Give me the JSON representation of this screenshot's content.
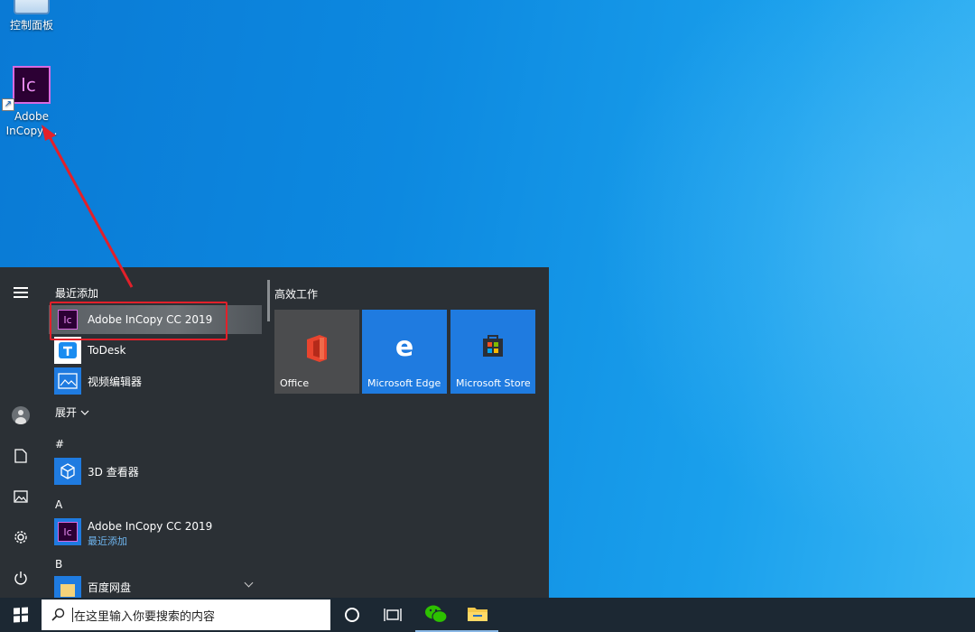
{
  "desktop": {
    "icons": [
      {
        "label": "控制面板"
      },
      {
        "label_line1": "Adobe",
        "label_line2": "InCopy ..."
      }
    ]
  },
  "start_menu": {
    "recent_header": "最近添加",
    "recent_apps": [
      {
        "name": "Adobe InCopy CC 2019",
        "icon": "incopy-icon"
      },
      {
        "name": "ToDesk",
        "icon": "todesk-icon"
      },
      {
        "name": "视频编辑器",
        "icon": "video-editor-icon"
      }
    ],
    "expand_label": "展开",
    "groups": [
      {
        "letter": "#",
        "apps": [
          {
            "name": "3D 查看器",
            "icon": "3d-viewer-icon"
          }
        ]
      },
      {
        "letter": "A",
        "apps": [
          {
            "name": "Adobe InCopy CC 2019",
            "sub": "最近添加",
            "icon": "incopy-icon"
          }
        ]
      },
      {
        "letter": "B",
        "apps": [
          {
            "name": "百度网盘",
            "icon": "folder-icon"
          }
        ]
      }
    ],
    "tiles_header": "高效工作",
    "tiles": [
      {
        "name": "Office",
        "icon": "office-icon",
        "color": "#4b4c4e"
      },
      {
        "name": "Microsoft Edge",
        "icon": "edge-icon",
        "color": "#1f7be0"
      },
      {
        "name": "Microsoft Store",
        "icon": "store-icon",
        "color": "#1f7be0"
      }
    ]
  },
  "taskbar": {
    "search_placeholder": "在这里输入你要搜索的内容",
    "pinned": [
      "cortana-icon",
      "task-view-icon",
      "wechat-icon",
      "file-explorer-icon"
    ]
  },
  "colors": {
    "highlight_box": "#e2202a",
    "start_bg": "#2b3035",
    "taskbar_bg": "#1c2833",
    "accent": "#1f7be0"
  }
}
